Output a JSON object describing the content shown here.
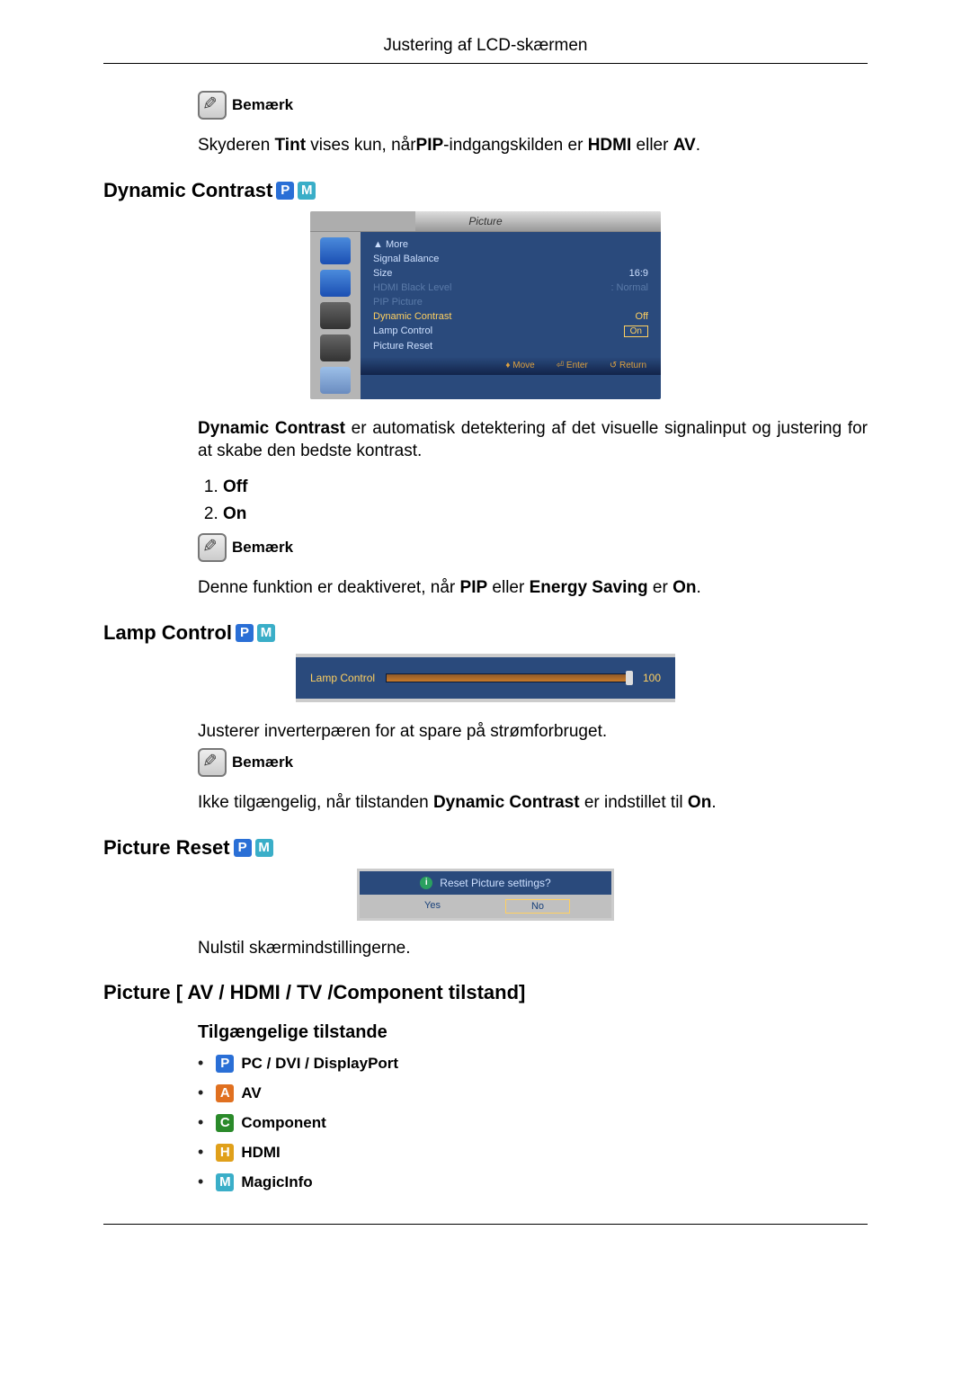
{
  "header": "Justering af LCD-skærmen",
  "note_label": "Bemærk",
  "notes": {
    "tint": {
      "pre": "Skyderen ",
      "b1": "Tint",
      "mid": " vises kun, når",
      "b2": "PIP",
      "mid2": "-indgangskilden er ",
      "b3": "HDMI",
      "mid3": " eller ",
      "b4": "AV",
      "post": "."
    },
    "dc_disabled": {
      "pre": "Denne funktion er deaktiveret, når ",
      "b1": "PIP",
      "mid": " eller ",
      "b2": "Energy Saving",
      "mid2": " er ",
      "b3": "On",
      "post": "."
    },
    "lamp_unavail": {
      "pre": "Ikke tilgængelig, når tilstanden ",
      "b1": "Dynamic Contrast",
      "mid": " er indstillet til ",
      "b2": "On",
      "post": "."
    }
  },
  "sections": {
    "dc_title": "Dynamic Contrast",
    "dc_desc": {
      "b1": "Dynamic Contrast",
      "rest": " er automatisk detektering af det visuelle signalinput og justering for at skabe den bedste kontrast."
    },
    "dc_opts": [
      "Off",
      "On"
    ],
    "lamp_title": "Lamp Control",
    "lamp_desc": "Justerer inverterpæren for at spare på strømforbruget.",
    "pr_title": "Picture Reset",
    "pr_desc": "Nulstil skærmindstillingerne.",
    "pic_modes_title": "Picture [ AV / HDMI / TV /Component tilstand]",
    "avail_modes_heading": "Tilgængelige tilstande",
    "modes": {
      "p": "PC / DVI / DisplayPort",
      "a": "AV",
      "c": "Component",
      "h": "HDMI",
      "m": "MagicInfo"
    }
  },
  "badges": {
    "P": "P",
    "M": "M"
  },
  "osd": {
    "picture": {
      "title": "Picture",
      "rows": [
        {
          "label": "▲ More",
          "val": ""
        },
        {
          "label": "Signal Balance",
          "val": ""
        },
        {
          "label": "Size",
          "val": "16:9"
        },
        {
          "label": "HDMI Black Level",
          "val": ": Normal",
          "dim": true
        },
        {
          "label": "PIP Picture",
          "val": "",
          "dim": true
        },
        {
          "label": "Dynamic Contrast",
          "val": "Off",
          "sel": true
        },
        {
          "label": "Lamp Control",
          "val": "On",
          "box": true
        },
        {
          "label": "Picture Reset",
          "val": ""
        }
      ],
      "footer": {
        "move": "Move",
        "enter": "Enter",
        "ret": "Return"
      }
    },
    "lamp": {
      "label": "Lamp Control",
      "value": "100"
    },
    "reset": {
      "prompt": "Reset Picture settings?",
      "yes": "Yes",
      "no": "No"
    }
  }
}
